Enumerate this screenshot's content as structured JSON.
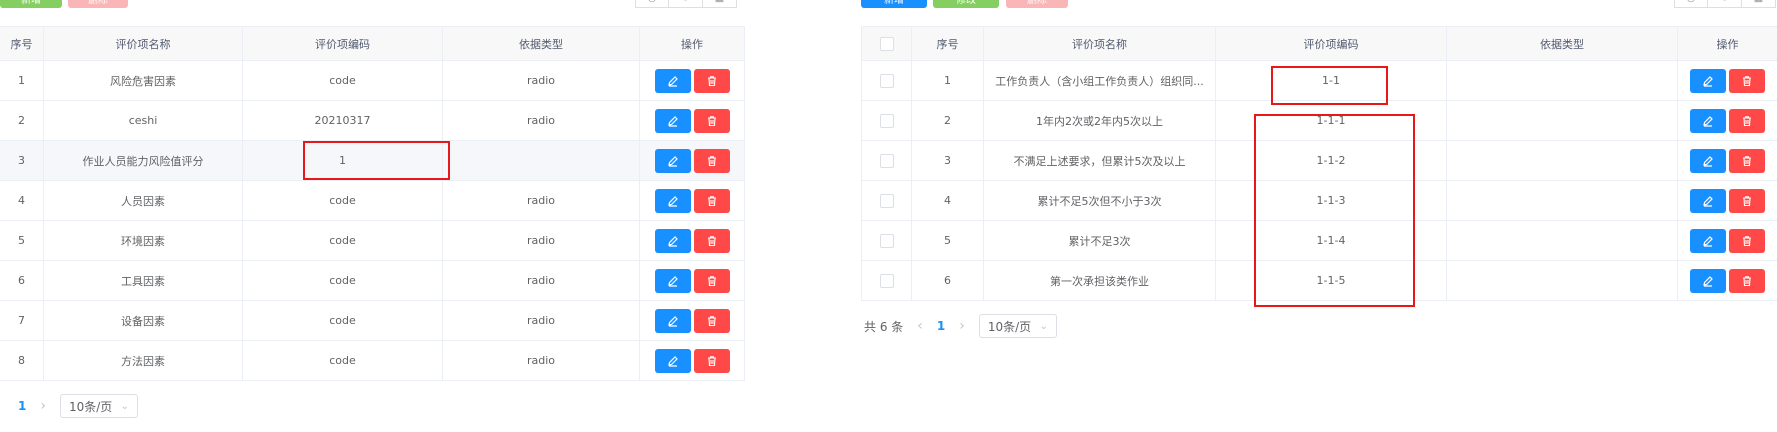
{
  "left": {
    "toolbar": {
      "buttons": [
        {
          "label": "新增",
          "color": "#85ce61"
        },
        {
          "label": "删除",
          "color": "#fab6b6"
        }
      ]
    },
    "columns": [
      "序号",
      "评价项名称",
      "评价项编码",
      "依据类型",
      "操作"
    ],
    "rows": [
      {
        "no": "1",
        "name": "风险危害因素",
        "code": "code",
        "type": "radio"
      },
      {
        "no": "2",
        "name": "ceshi",
        "code": "20210317",
        "type": "radio"
      },
      {
        "no": "3",
        "name": "作业人员能力风险值评分",
        "code": "1",
        "type": ""
      },
      {
        "no": "4",
        "name": "人员因素",
        "code": "code",
        "type": "radio"
      },
      {
        "no": "5",
        "name": "环境因素",
        "code": "code",
        "type": "radio"
      },
      {
        "no": "6",
        "name": "工具因素",
        "code": "code",
        "type": "radio"
      },
      {
        "no": "7",
        "name": "设备因素",
        "code": "code",
        "type": "radio"
      },
      {
        "no": "8",
        "name": "方法因素",
        "code": "code",
        "type": "radio"
      }
    ],
    "pager": {
      "page": "1",
      "size": "10条/页"
    }
  },
  "right": {
    "toolbar": {
      "buttons": [
        {
          "label": "新增",
          "color": "#1890ff"
        },
        {
          "label": "修改",
          "color": "#85ce61"
        },
        {
          "label": "删除",
          "color": "#fab6b6"
        }
      ]
    },
    "columns": [
      "序号",
      "评价项名称",
      "评价项编码",
      "依据类型",
      "操作"
    ],
    "rows": [
      {
        "no": "1",
        "name": "工作负责人（含小组工作负责人）组织同...",
        "code": "1-1",
        "type": ""
      },
      {
        "no": "2",
        "name": "1年内2次或2年内5次以上",
        "code": "1-1-1",
        "type": ""
      },
      {
        "no": "3",
        "name": "不满足上述要求，但累计5次及以上",
        "code": "1-1-2",
        "type": ""
      },
      {
        "no": "4",
        "name": "累计不足5次但不小于3次",
        "code": "1-1-3",
        "type": ""
      },
      {
        "no": "5",
        "name": "累计不足3次",
        "code": "1-1-4",
        "type": ""
      },
      {
        "no": "6",
        "name": "第一次承担该类作业",
        "code": "1-1-5",
        "type": ""
      }
    ],
    "pager": {
      "total": "共 6 条",
      "page": "1",
      "size": "10条/页"
    }
  },
  "icons": {
    "search": "search-icon",
    "refresh": "refresh-icon",
    "columns": "columns-icon",
    "edit": "edit-icon",
    "delete": "trash-icon"
  },
  "colors": {
    "primary": "#1890ff",
    "danger": "#ff4949",
    "highlight": "#e81818"
  }
}
